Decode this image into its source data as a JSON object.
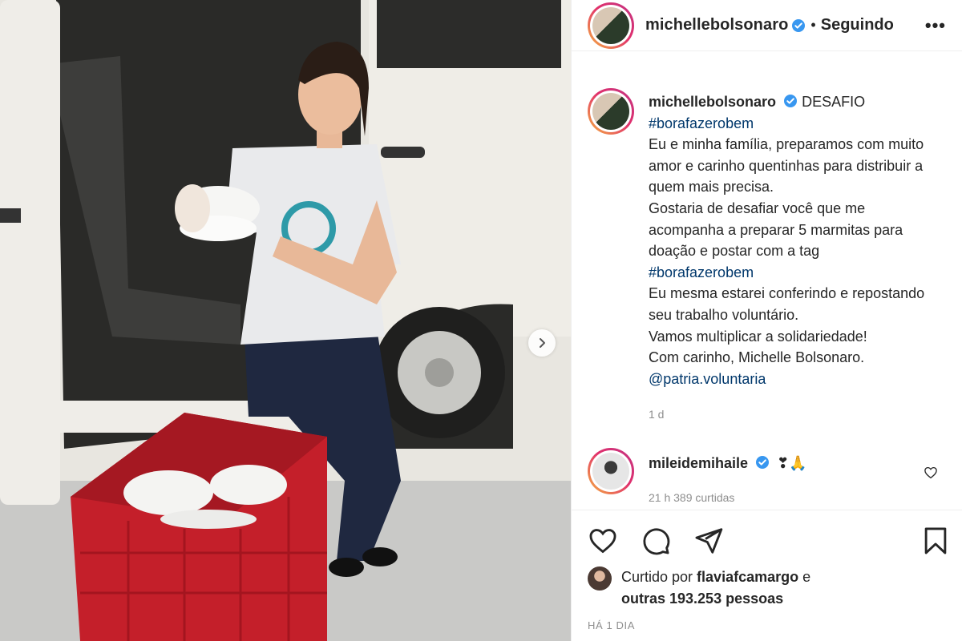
{
  "post": {
    "username": "michellebolsonaro",
    "follow_status": "Seguindo",
    "more_label": "•••",
    "dot": "•"
  },
  "caption": {
    "username": "michellebolsonaro",
    "lines": [
      "DESAFIO",
      "#borafazerobem",
      "Eu e minha família, preparamos com muito amor e carinho quentinhas para distribuir a quem mais precisa.",
      "Gostaria de desafiar você que me acompanha a preparar 5 marmitas para doação e postar com a tag",
      "#borafazerobem",
      "Eu mesma estarei conferindo e repostando seu trabalho voluntário.",
      "Vamos multiplicar a solidariedade!",
      "Com carinho, Michelle Bolsonaro.",
      "@patria.voluntaria"
    ],
    "time": "1 d"
  },
  "comment": {
    "username": "mileidemihaile",
    "text": "❣🙏",
    "meta": "21 h   389 curtidas"
  },
  "likes": {
    "prefix": "Curtido por ",
    "user": "flaviafcamargo",
    "suffix": " e",
    "others": "outras 193.253 pessoas"
  },
  "date": "HÁ 1 DIA",
  "icons": {
    "like": "heart-icon",
    "comment": "comment-icon",
    "share": "share-icon",
    "save": "bookmark-icon",
    "next": "chevron-right-icon",
    "verified": "verified-badge-icon"
  },
  "colors": {
    "link": "#00376b",
    "verified": "#3897f0",
    "meta": "#8e8e8e",
    "crate": "#c81e2c"
  }
}
